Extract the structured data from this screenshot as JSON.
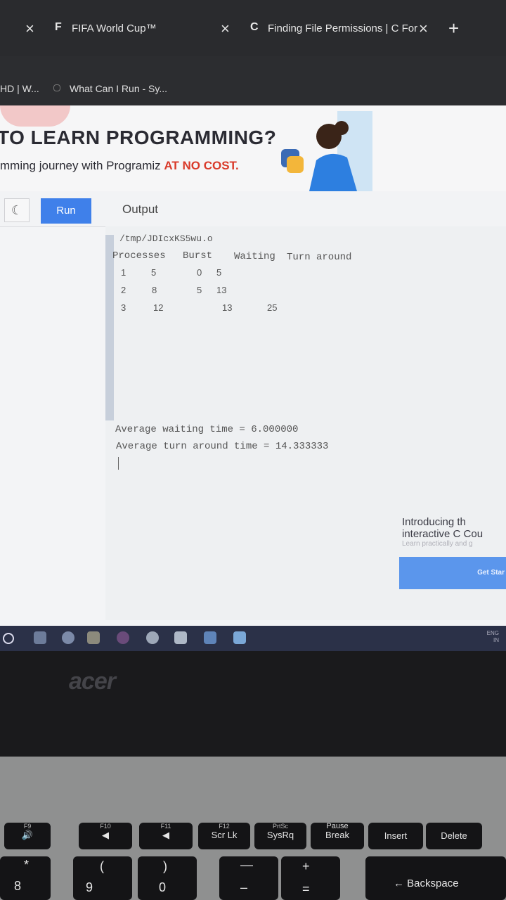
{
  "browser": {
    "tabs": [
      {
        "favicon": "F",
        "title": "FIFA World Cup™"
      },
      {
        "favicon": "C",
        "title": "Finding File Permissions | C For"
      }
    ],
    "close_glyph": "×",
    "new_tab_glyph": "+",
    "bookmarks": [
      {
        "label": "HD | W..."
      },
      {
        "label": "What Can I Run - Sy..."
      }
    ]
  },
  "banner": {
    "headline": "TO LEARN PROGRAMMING?",
    "subline_prefix": "mming journey with Programiz ",
    "subline_highlight": "AT NO COST."
  },
  "toolbar": {
    "run_label": "Run",
    "output_label": "Output"
  },
  "console": {
    "path": "/tmp/JDIcxKS5wu.o",
    "headers": [
      "Processes",
      "Burst",
      "Waiting",
      "Turn around"
    ],
    "rows": [
      [
        "1",
        "5",
        "0",
        "5"
      ],
      [
        "2",
        "8",
        "5",
        "13"
      ],
      [
        "3",
        "12",
        "13",
        "25"
      ]
    ],
    "avg_waiting": "Average waiting time = 6.000000",
    "avg_turnaround": "Average turn around time = 14.333333"
  },
  "promo": {
    "line1": "Introducing th",
    "line2": "interactive C Cou",
    "line3": "Learn practically and g",
    "button": "Get Star"
  },
  "taskbar": {
    "tray_lang": "ENG",
    "tray_region": "IN"
  },
  "laptop": {
    "brand": "acer",
    "keys_top": [
      {
        "top": "F9",
        "main": "🔊"
      },
      {
        "top": "F10",
        "main": ""
      },
      {
        "top": "F11",
        "main": ""
      },
      {
        "top": "F12",
        "main": "Scr Lk"
      },
      {
        "top": "PrtSc",
        "main": "SysRq"
      },
      {
        "top": "Pause",
        "main": "Break"
      },
      {
        "top": "",
        "main": "Insert"
      },
      {
        "top": "",
        "main": "Delete"
      }
    ],
    "keys_bottom": [
      {
        "upper": "*",
        "lower": "8"
      },
      {
        "upper": "(",
        "lower": "9"
      },
      {
        "upper": ")",
        "lower": "0"
      },
      {
        "upper": "—",
        "lower": "–"
      },
      {
        "upper": "+",
        "lower": "="
      },
      {
        "upper": "",
        "lower": "← Backspace"
      }
    ]
  },
  "colors": {
    "run_button": "#3f80ea",
    "highlight": "#d93a2a",
    "taskbar": "#2b3148"
  }
}
